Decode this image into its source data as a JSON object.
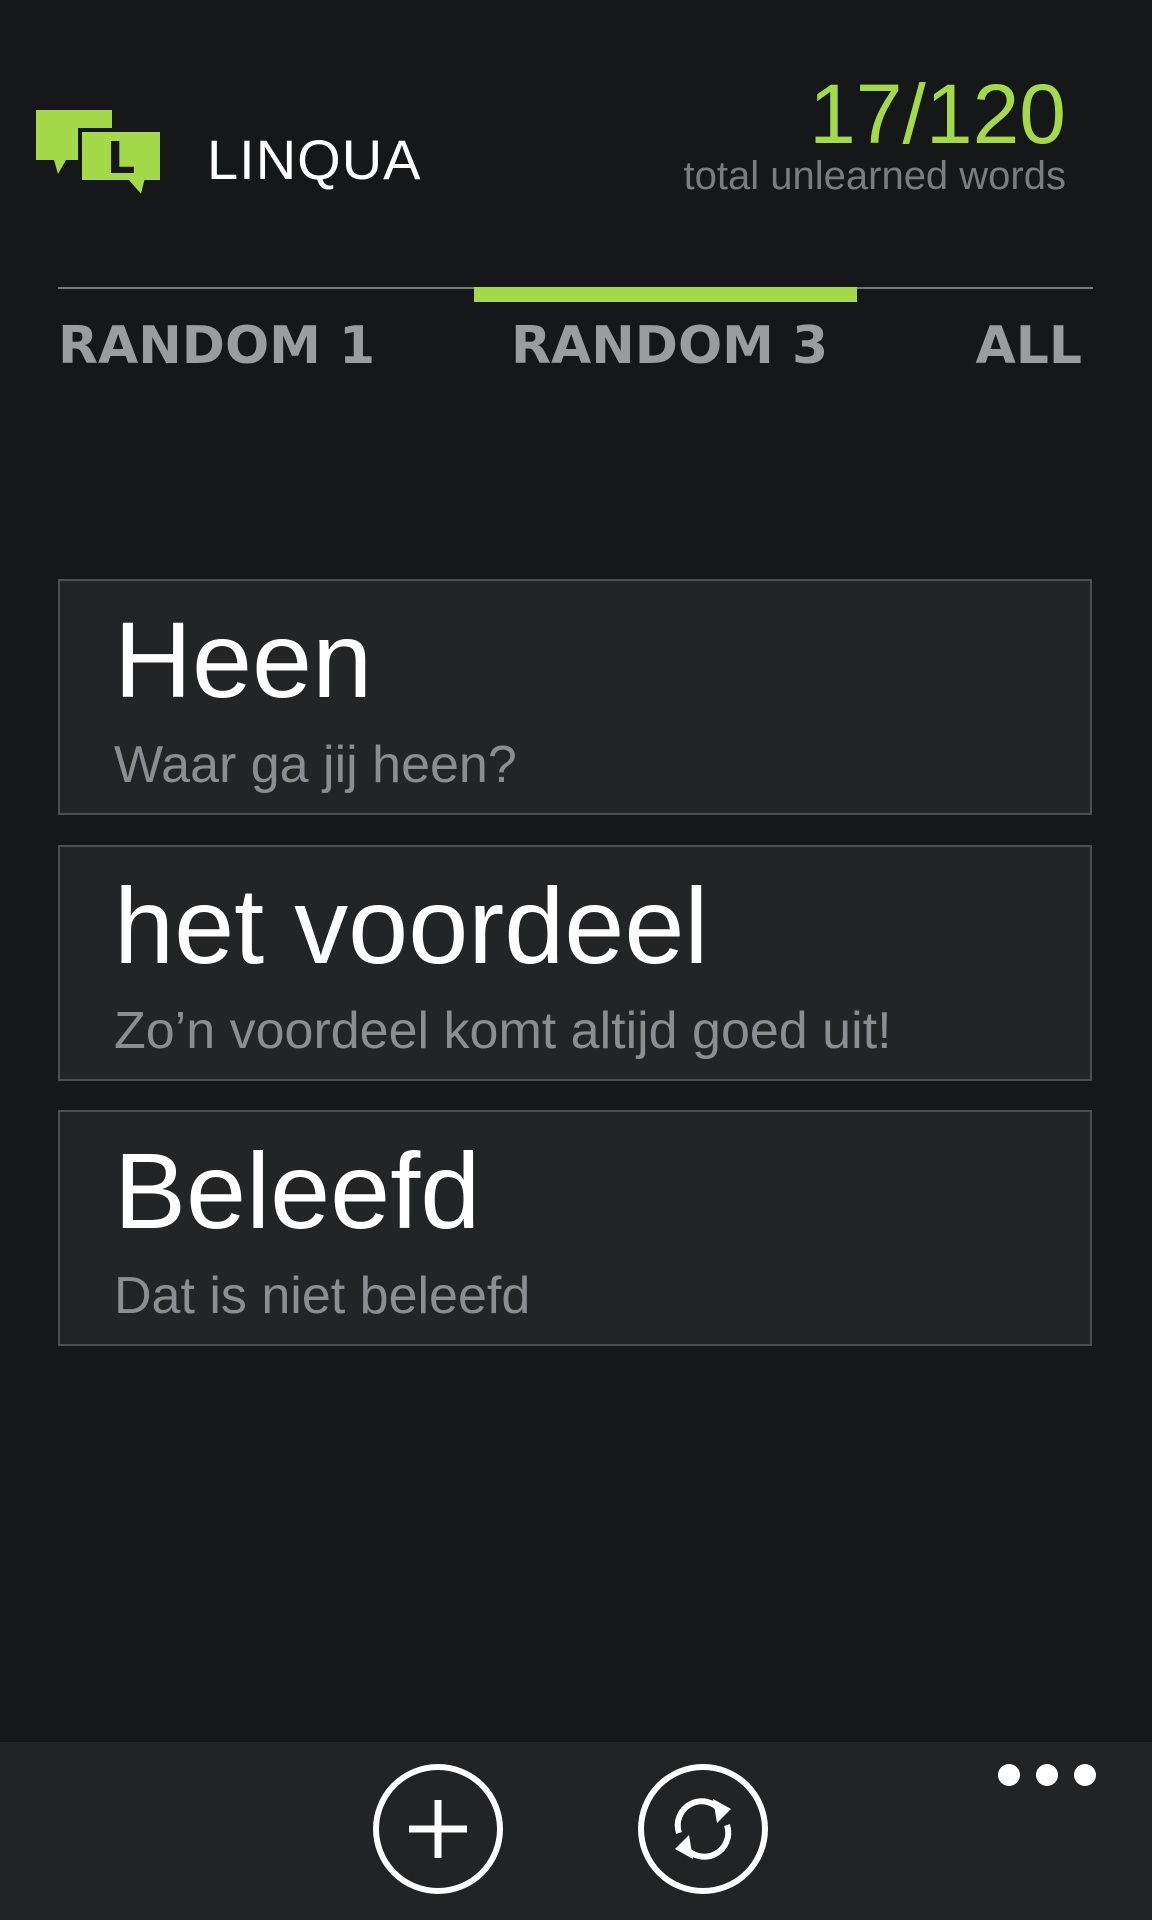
{
  "header": {
    "app_title": "LINQUA",
    "logo_letter": "L",
    "counter": "17/120",
    "counter_label": "total unlearned words"
  },
  "tabs": [
    {
      "label": "RANDOM 1",
      "selected": false
    },
    {
      "label": "RANDOM 3",
      "selected": true
    },
    {
      "label": "ALL",
      "selected": false
    }
  ],
  "cards": [
    {
      "word": "Heen",
      "example": "Waar ga jij heen?"
    },
    {
      "word": "het voordeel",
      "example": "Zo’n voordeel komt altijd goed uit!"
    },
    {
      "word": "Beleefd",
      "example": "Dat is niet beleefd"
    }
  ],
  "appbar": {
    "buttons": [
      {
        "icon": "add-icon"
      },
      {
        "icon": "sync-icon"
      }
    ],
    "more_icon": "ellipsis-icon"
  },
  "colors": {
    "accent": "#a4d94a",
    "background": "#161719",
    "card": "#232426",
    "appbar": "#222325"
  }
}
